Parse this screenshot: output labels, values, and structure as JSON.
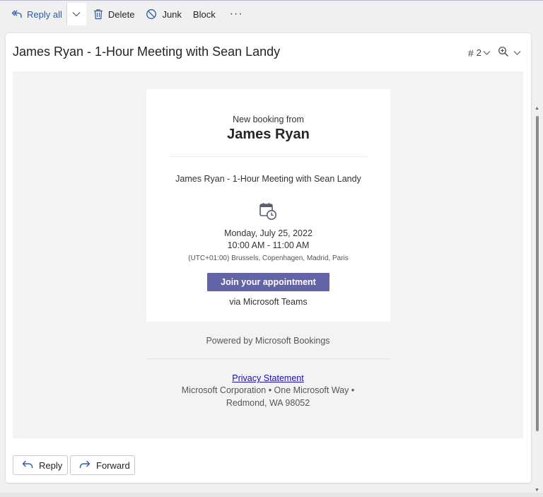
{
  "toolbar": {
    "reply_all_label": "Reply all",
    "delete_label": "Delete",
    "junk_label": "Junk",
    "block_label": "Block",
    "more_label": "···"
  },
  "header": {
    "subject": "James Ryan - 1-Hour Meeting with Sean Landy",
    "count": "2"
  },
  "booking": {
    "intro": "New booking from",
    "name": "James Ryan",
    "meeting_title": "James Ryan - 1-Hour Meeting with Sean Landy",
    "date": "Monday, July 25, 2022",
    "time": "10:00 AM - 11:00 AM",
    "timezone": "(UTC+01:00) Brussels, Copenhagen, Madrid, Paris",
    "join_label": "Join your appointment",
    "via": "via Microsoft Teams"
  },
  "footer": {
    "powered": "Powered by Microsoft Bookings",
    "privacy": "Privacy Statement",
    "corp_line": "Microsoft Corporation • One Microsoft Way •",
    "address": "Redmond, WA 98052"
  },
  "actions": {
    "reply_label": "Reply",
    "forward_label": "Forward"
  },
  "colors": {
    "teams_purple": "#6264a7",
    "link_blue": "#1a0dab",
    "accent_blue": "#2d5aa6"
  },
  "icons": [
    "reply-all-icon",
    "chevron-down-icon",
    "trash-icon",
    "block-icon",
    "more-icon",
    "zoom-icon",
    "calendar-clock-icon",
    "reply-icon",
    "forward-icon"
  ]
}
